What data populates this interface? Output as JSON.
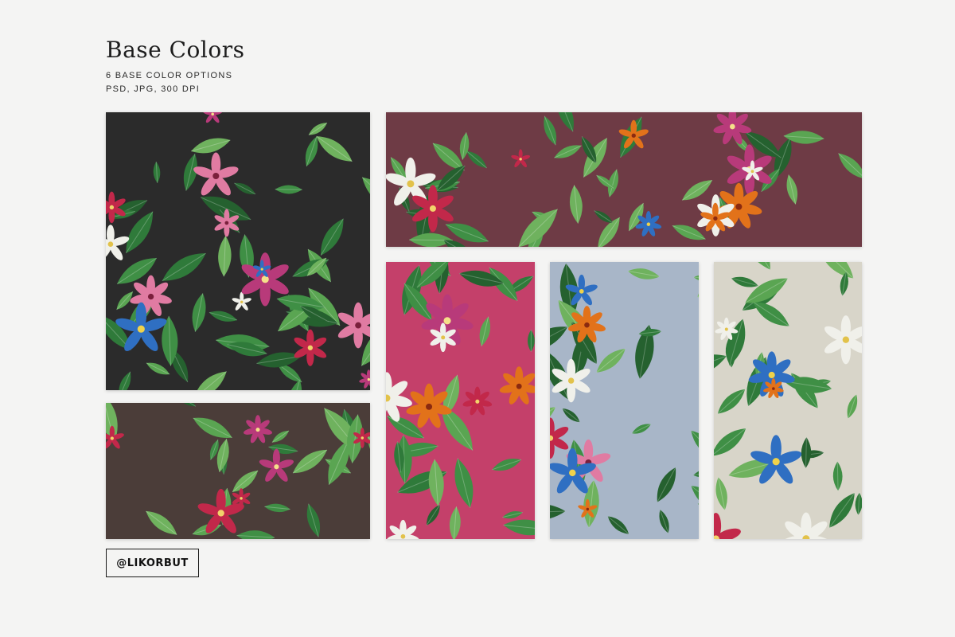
{
  "header": {
    "title": "Base Colors",
    "line1": "6 BASE COLOR OPTIONS",
    "line2": "PSD, JPG, 300 DPI"
  },
  "swatches": [
    {
      "id": "sw-dark",
      "name": "swatch-charcoal",
      "bg": "#2b2b2b"
    },
    {
      "id": "sw-wine",
      "name": "swatch-wine",
      "bg": "#6e3b45"
    },
    {
      "id": "sw-brown",
      "name": "swatch-brown",
      "bg": "#4b3d39"
    },
    {
      "id": "sw-pink",
      "name": "swatch-raspberry",
      "bg": "#c4406a"
    },
    {
      "id": "sw-blue",
      "name": "swatch-powder-blue",
      "bg": "#a8b6c8"
    },
    {
      "id": "sw-cream",
      "name": "swatch-cream",
      "bg": "#d8d5c9"
    }
  ],
  "badge": {
    "text": "@LIKORBUT"
  }
}
